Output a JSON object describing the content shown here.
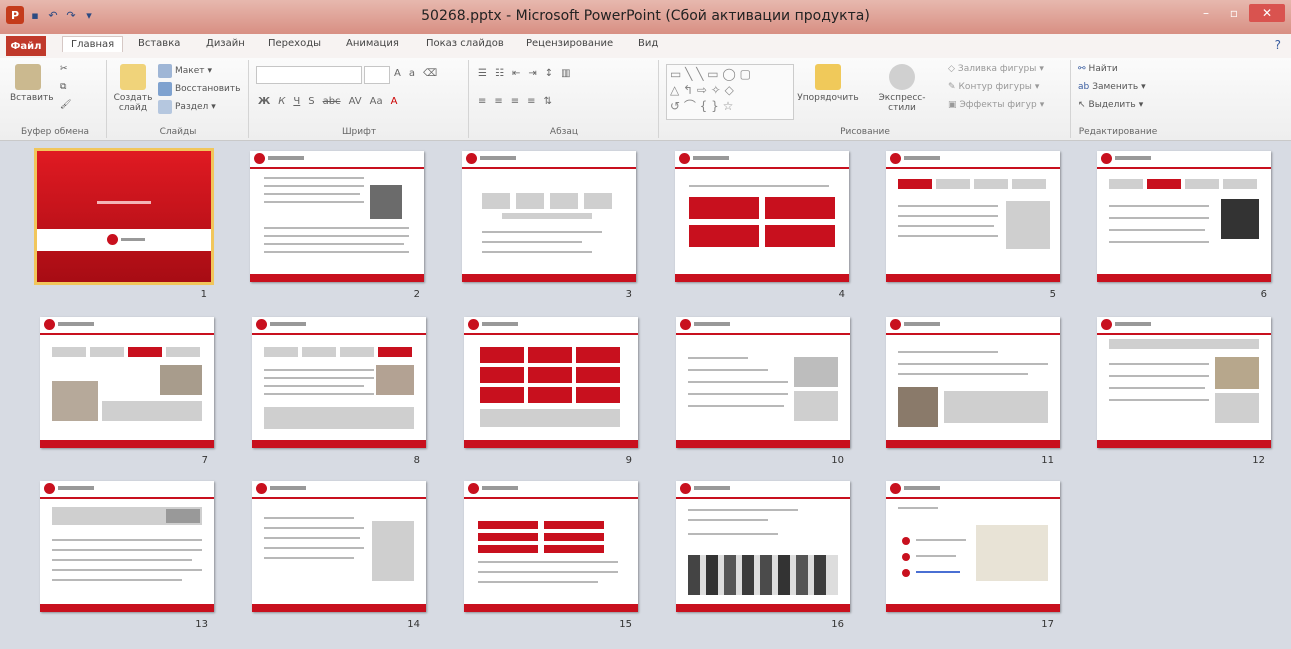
{
  "window": {
    "title": "50268.pptx - Microsoft PowerPoint (Сбой активации продукта)"
  },
  "tabs": [
    "Файл",
    "Главная",
    "Вставка",
    "Дизайн",
    "Переходы",
    "Анимация",
    "Показ слайдов",
    "Рецензирование",
    "Вид"
  ],
  "ribbon": {
    "clipboard": {
      "paste": "Вставить",
      "label": "Буфер обмена"
    },
    "slides": {
      "new_slide": "Создать слайд",
      "layout": "Макет",
      "reset": "Восстановить",
      "section": "Раздел",
      "label": "Слайды"
    },
    "font": {
      "label": "Шрифт"
    },
    "paragraph": {
      "label": "Абзац"
    },
    "drawing": {
      "arrange": "Упорядочить",
      "quick_styles": "Экспресс-стили",
      "fill": "Заливка фигуры",
      "outline": "Контур фигуры",
      "effects": "Эффекты фигур",
      "label": "Рисование"
    },
    "editing": {
      "find": "Найти",
      "replace": "Заменить",
      "select": "Выделить",
      "label": "Редактирование"
    }
  },
  "slides": [
    {
      "num": "1",
      "selected": true,
      "kind": "title"
    },
    {
      "num": "2",
      "kind": "text-photo"
    },
    {
      "num": "3",
      "kind": "boxes-grey"
    },
    {
      "num": "4",
      "kind": "red-boxes-4"
    },
    {
      "num": "5",
      "kind": "tabs-text"
    },
    {
      "num": "6",
      "kind": "tabs-photo"
    },
    {
      "num": "7",
      "kind": "tabs-collage"
    },
    {
      "num": "8",
      "kind": "tabs-list"
    },
    {
      "num": "9",
      "kind": "red-grid"
    },
    {
      "num": "10",
      "kind": "text-photo-right"
    },
    {
      "num": "11",
      "kind": "text-photo-left"
    },
    {
      "num": "12",
      "kind": "text-photo-right2"
    },
    {
      "num": "13",
      "kind": "banner-text"
    },
    {
      "num": "14",
      "kind": "text-photo-right3"
    },
    {
      "num": "15",
      "kind": "red-boxes-text"
    },
    {
      "num": "16",
      "kind": "team-photo"
    },
    {
      "num": "17",
      "kind": "contacts-map"
    }
  ]
}
